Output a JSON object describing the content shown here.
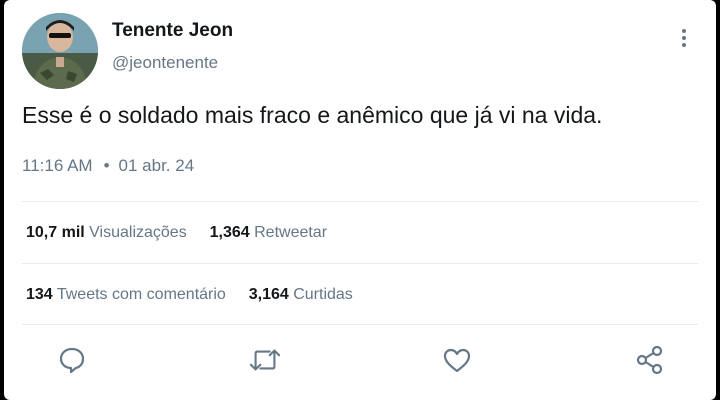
{
  "author": {
    "name": "Tenente Jeon",
    "handle": "@jeontenente",
    "avatar_icon": "profile-photo-soldier"
  },
  "tweet": {
    "text": "Esse é o soldado mais fraco e anêmico que já vi na vida.",
    "time": "11:16 AM",
    "separator": "•",
    "date": "01 abr. 24"
  },
  "stats": {
    "views_count": "10,7 mil",
    "views_label": "Visualizações",
    "retweets_count": "1,364",
    "retweets_label": "Retweetar",
    "comments_count": "134",
    "comments_label": "Tweets com comentário",
    "likes_count": "3,164",
    "likes_label": "Curtidas"
  },
  "actions": [
    "reply-icon",
    "retweet-icon",
    "like-icon",
    "share-icon"
  ],
  "colors": {
    "text": "#14171a",
    "secondary": "#657786",
    "divider": "#e6ecf0",
    "background": "#ffffff"
  }
}
